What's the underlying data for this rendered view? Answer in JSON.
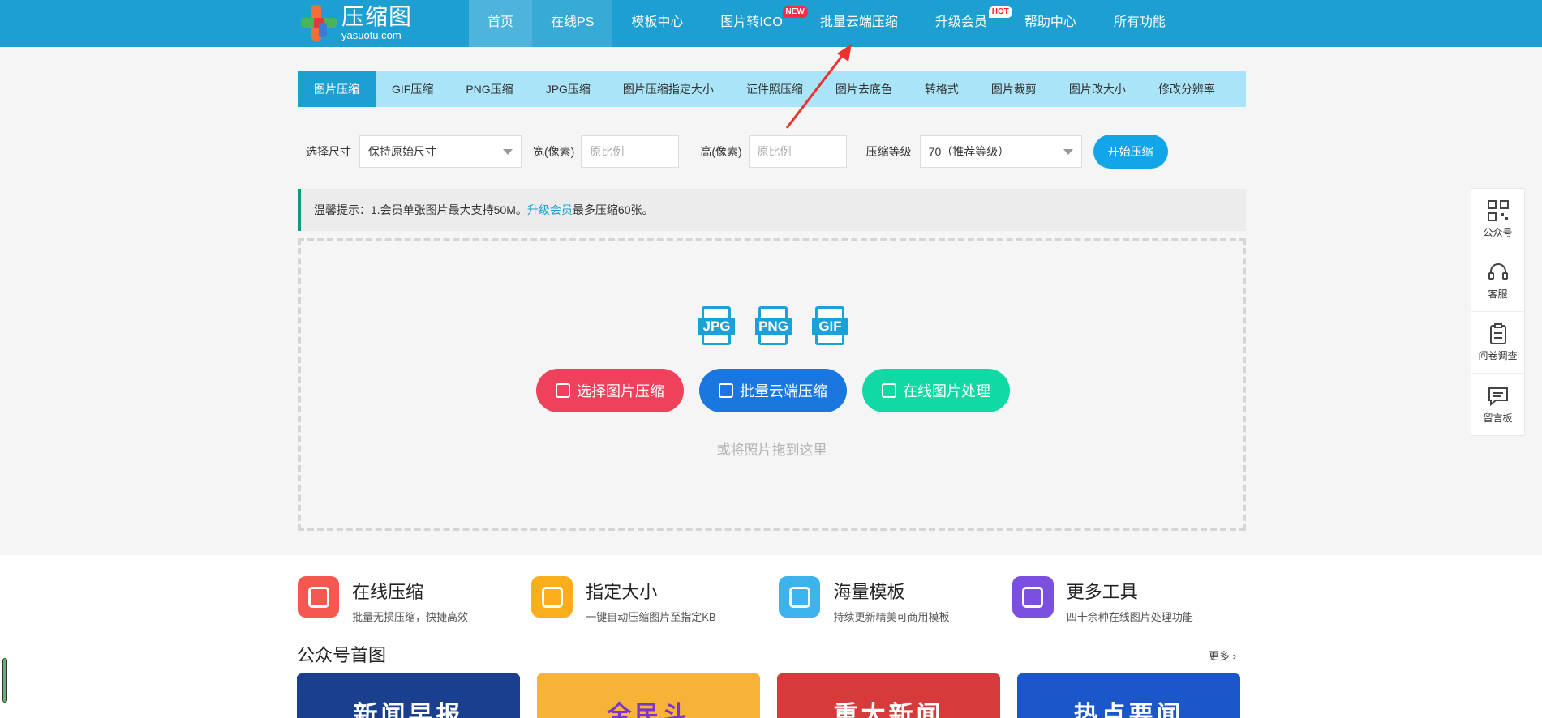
{
  "logo": {
    "cn": "压缩图",
    "en": "yasuotu.com"
  },
  "nav": [
    {
      "label": "首页"
    },
    {
      "label": "在线PS"
    },
    {
      "label": "模板中心"
    },
    {
      "label": "图片转ICO",
      "badge": "NEW"
    },
    {
      "label": "批量云端压缩"
    },
    {
      "label": "升级会员",
      "badge": "HOT"
    },
    {
      "label": "帮助中心"
    },
    {
      "label": "所有功能"
    }
  ],
  "tabs": [
    "图片压缩",
    "GIF压缩",
    "PNG压缩",
    "JPG压缩",
    "图片压缩指定大小",
    "证件照压缩",
    "图片去底色",
    "转格式",
    "图片裁剪",
    "图片改大小",
    "修改分辨率"
  ],
  "options": {
    "size_label": "选择尺寸",
    "size_value": "保持原始尺寸",
    "width_label": "宽(像素)",
    "width_placeholder": "原比例",
    "height_label": "高(像素)",
    "height_placeholder": "原比例",
    "level_label": "压缩等级",
    "level_value": "70（推荐等级）",
    "start_label": "开始压缩"
  },
  "notice": {
    "prefix": "温馨提示：1.会员单张图片最大支持50M。",
    "link": "升级会员",
    "suffix": "最多压缩60张。"
  },
  "drop": {
    "file_types": [
      "JPG",
      "PNG",
      "GIF"
    ],
    "buttons": [
      "选择图片压缩",
      "批量云端压缩",
      "在线图片处理"
    ],
    "hint": "或将照片拖到这里"
  },
  "sidepanel": [
    "公众号",
    "客服",
    "问卷调查",
    "留言板"
  ],
  "features": [
    {
      "title": "在线压缩",
      "desc": "批量无损压缩，快捷高效",
      "color": "#f5584f"
    },
    {
      "title": "指定大小",
      "desc": "一键自动压缩图片至指定KB",
      "color": "#fbae1c"
    },
    {
      "title": "海量模板",
      "desc": "持续更新精美可商用模板",
      "color": "#3db3ee"
    },
    {
      "title": "更多工具",
      "desc": "四十余种在线图片处理功能",
      "color": "#7b4fe0"
    }
  ],
  "section": {
    "title": "公众号首图",
    "more": "更多 ›"
  },
  "cards": [
    {
      "text": "新闻早报",
      "bg": "#1b3f8f",
      "fg": "#ffffff"
    },
    {
      "text": "全民斗",
      "bg": "#f7b23a",
      "fg": "#7b35c7"
    },
    {
      "text": "重大新闻",
      "bg": "#d73a3a",
      "fg": "#ffffff"
    },
    {
      "text": "热点要闻",
      "bg": "#1b57c9",
      "fg": "#ffffff"
    }
  ],
  "colors": {
    "header": "#1d9fd1",
    "tab_bar": "#a9e4f8",
    "accent": "#12a6e8"
  }
}
